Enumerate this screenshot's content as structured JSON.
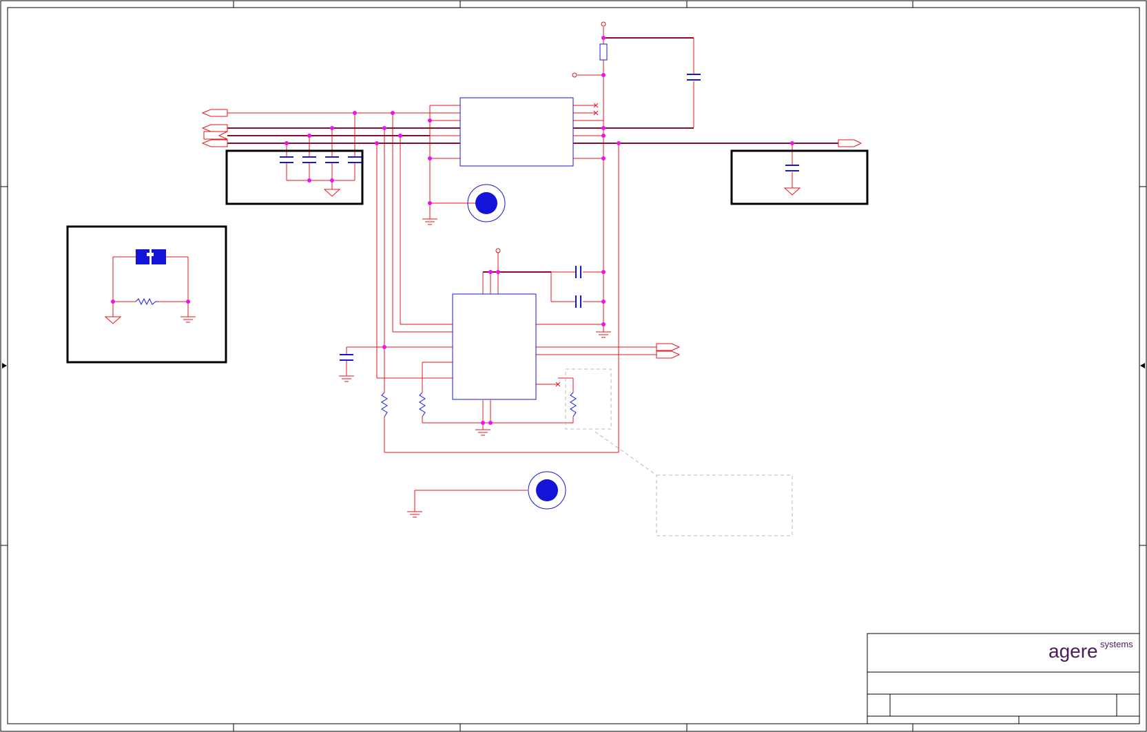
{
  "title_block": {
    "logo": {
      "brand": "agere",
      "suffix": "systems"
    }
  },
  "colors": {
    "wire": "#e8131a",
    "bus": "#8b0a2e",
    "component": "#1414d8",
    "junction": "#ee11ee",
    "frame": "#000000",
    "logo": "#4a1a5c",
    "note": "#b8b8b8"
  },
  "icons": {
    "mounting_hole": "circle-filled-icon",
    "ground": "ground-icon",
    "chassis_ground": "chassis-ground-icon",
    "net_port": "off-page-connector-icon"
  }
}
